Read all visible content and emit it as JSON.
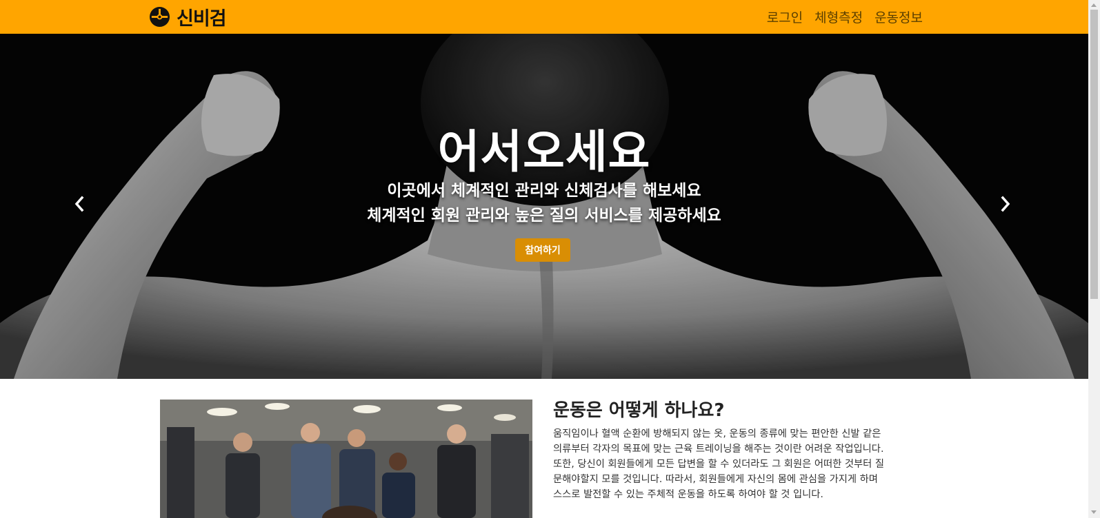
{
  "navbar": {
    "brand_name": "신비검",
    "links": [
      "로그인",
      "체형측정",
      "운동정보"
    ],
    "background_color": "#ffa500"
  },
  "hero": {
    "title": "어서오세요",
    "subtitle_line1": "이곳에서 체계적인 관리와 신체검사를 해보세요",
    "subtitle_line2": "체계적인 회원 관리와 높은 질의 서비스를 제공하세요",
    "cta_label": "참여하기",
    "cta_color": "#d98e04",
    "prev_icon": "chevron-left-icon",
    "next_icon": "chevron-right-icon"
  },
  "section": {
    "title": "운동은 어떻게 하나요?",
    "paragraph_lines": [
      "움직임이나 혈액 순환에 방해되지 않는 옷, 운동의 종류에 맞는 편안한 신발 같은",
      "의류부터 각자의 목표에 맞는 근육 트레이닝을 해주는 것이란 어려운 작업입니다.",
      "또한, 당신이 회원들에게 모든 답변을 할 수 있더라도 그 회원은 어떠한 것부터 질",
      "문해야할지 모를 것입니다. 따라서, 회원들에게 자신의 몸에 관심을 가지게 하며",
      "스스로 발전할 수 있는 주체적 운동을 하도록 하여야 할 것 입니다."
    ]
  }
}
